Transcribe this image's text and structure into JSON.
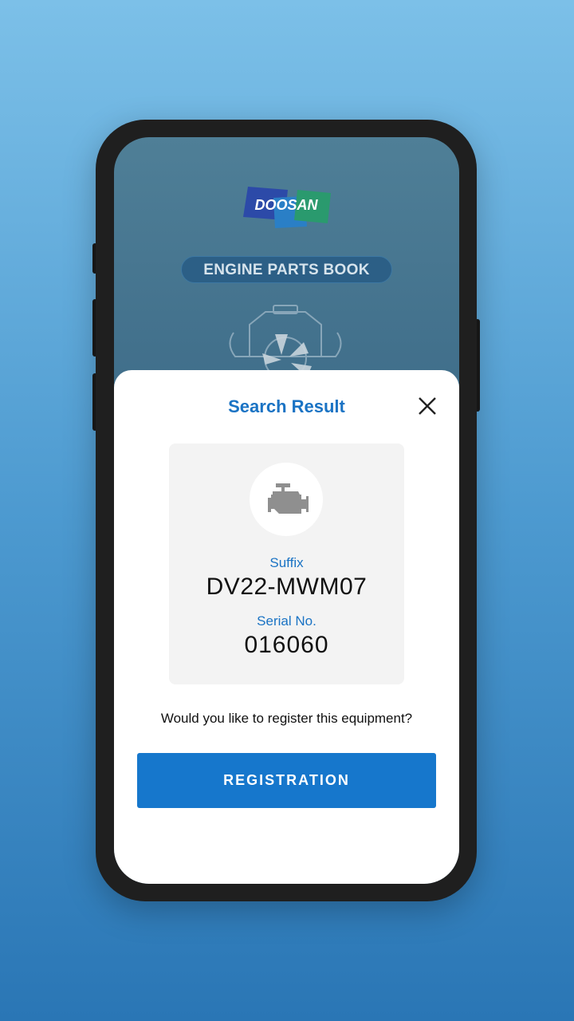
{
  "app": {
    "brand_logo_text": "DOOSAN",
    "banner_title": "ENGINE PARTS BOOK"
  },
  "dialog": {
    "title": "Search Result",
    "close_icon": "close-icon",
    "card": {
      "icon": "engine-icon",
      "suffix_label": "Suffix",
      "suffix_value": "DV22-MWM07",
      "serial_label": "Serial No.",
      "serial_value": "016060"
    },
    "question": "Would you like to register this equipment?",
    "register_button_label": "REGISTRATION"
  },
  "colors": {
    "accent": "#1a73c4",
    "button": "#1677cc",
    "card_background": "#f3f3f3"
  }
}
